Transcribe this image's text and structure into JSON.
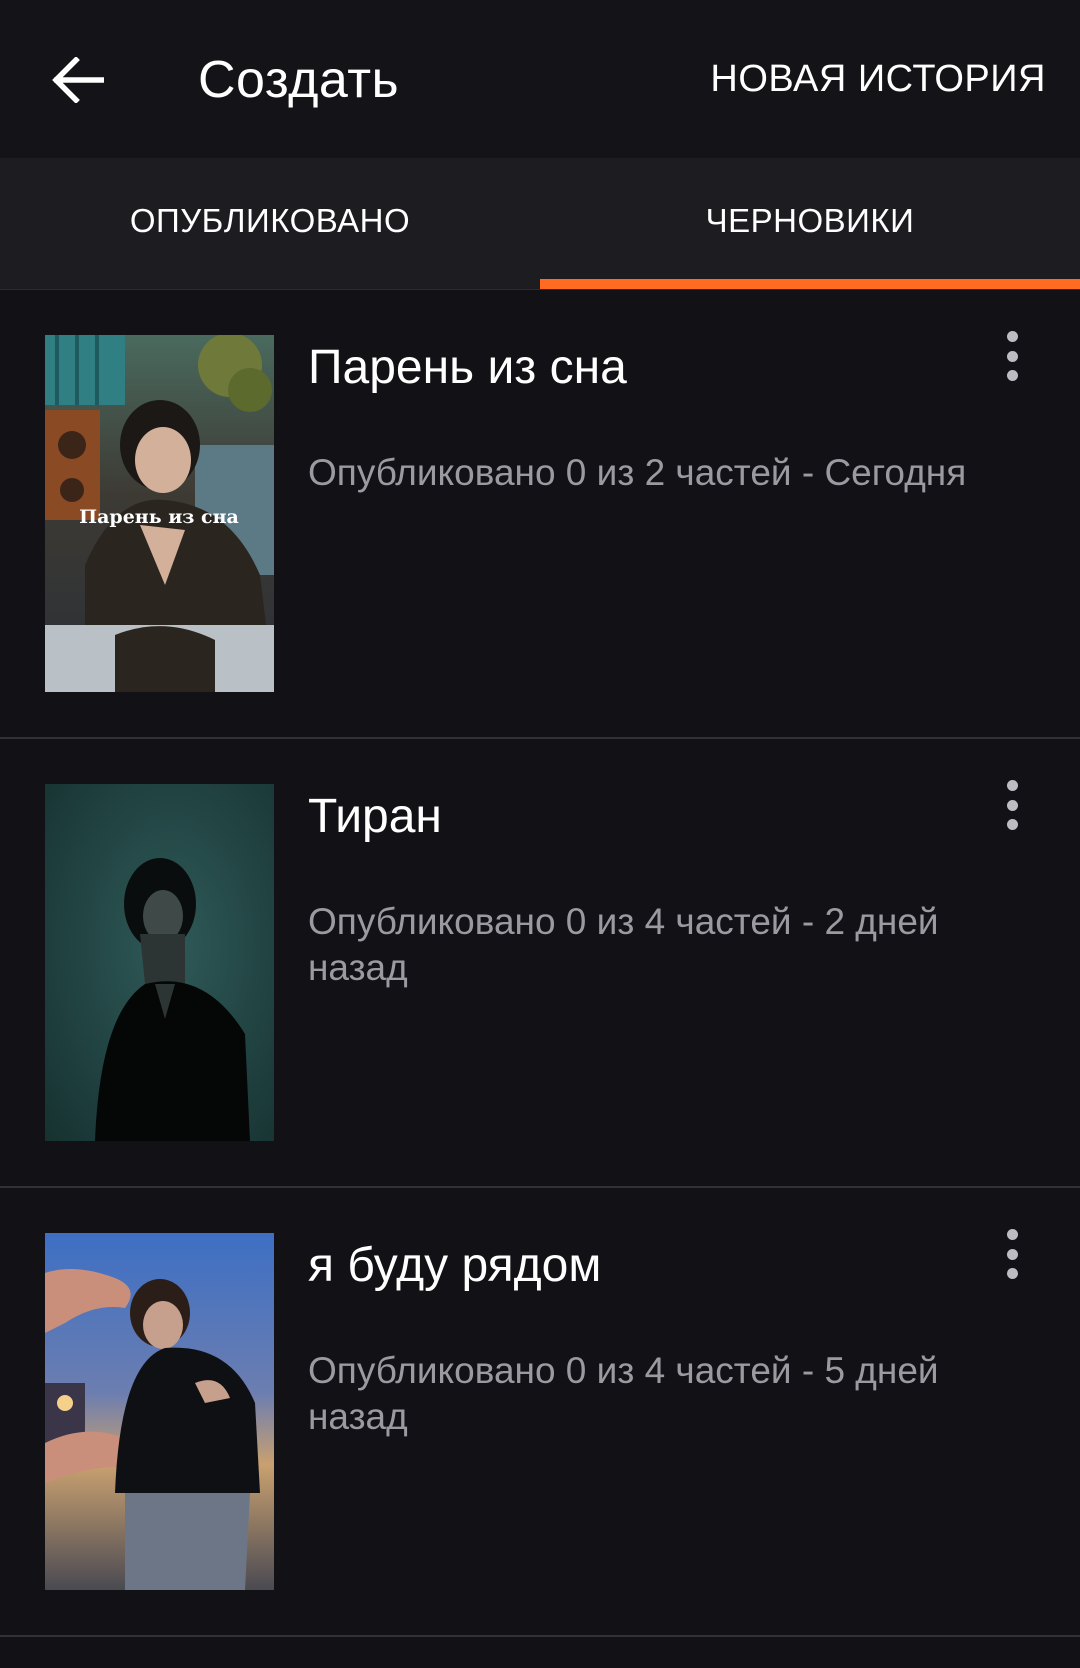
{
  "header": {
    "title": "Создать",
    "new_story_label": "НОВАЯ ИСТОРИЯ",
    "back_icon": "arrow-left-icon"
  },
  "tabs": [
    {
      "label": "ОПУБЛИКОВАНО",
      "active": false
    },
    {
      "label": "ЧЕРНОВИКИ",
      "active": true
    }
  ],
  "stories": [
    {
      "title": "Парень из сна",
      "meta": "Опубликовано 0 из 2 частей - Сегодня",
      "cover_caption": "Парень из сна"
    },
    {
      "title": "Тиран",
      "meta": "Опубликовано 0 из 4 частей - 2 дней назад"
    },
    {
      "title": "я буду рядом",
      "meta": "Опубликовано 0 из 4 частей - 5 дней назад"
    }
  ],
  "colors": {
    "accent": "#ff6b21",
    "background": "#121115",
    "tab_bar": "#1d1c21",
    "meta_text": "#9b9aa1"
  }
}
